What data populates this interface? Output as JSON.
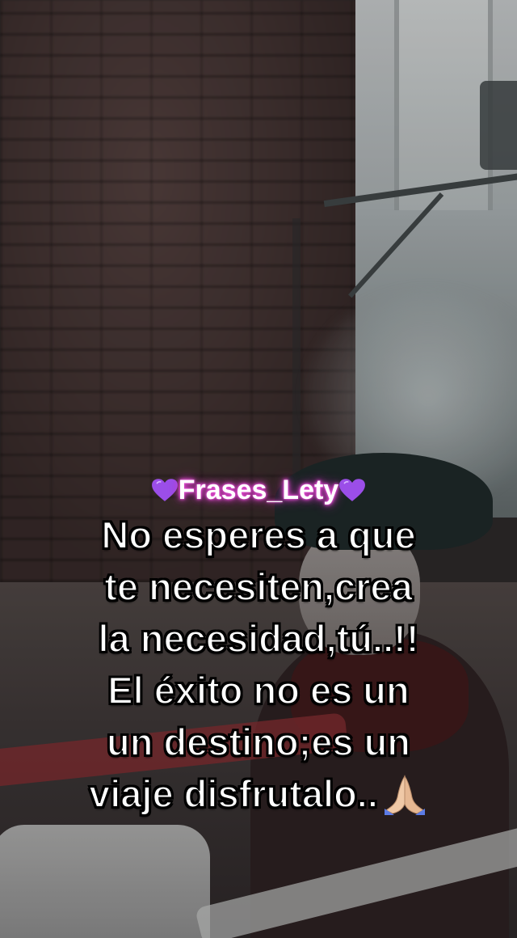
{
  "video": {
    "handle": "Frases_Lety",
    "handle_glow_color": "#e64bd6",
    "handle_icons": [
      "purple-heart-icon",
      "purple-heart-icon"
    ],
    "quote_lines": [
      "No esperes a que",
      "te necesiten,crea",
      "la necesidad,tú..!!",
      "El éxito no es un",
      "un destino;es un",
      "viaje disfrutalo.."
    ],
    "end_icon": "folded-hands-icon",
    "heart_color": "#9b4ee8"
  }
}
